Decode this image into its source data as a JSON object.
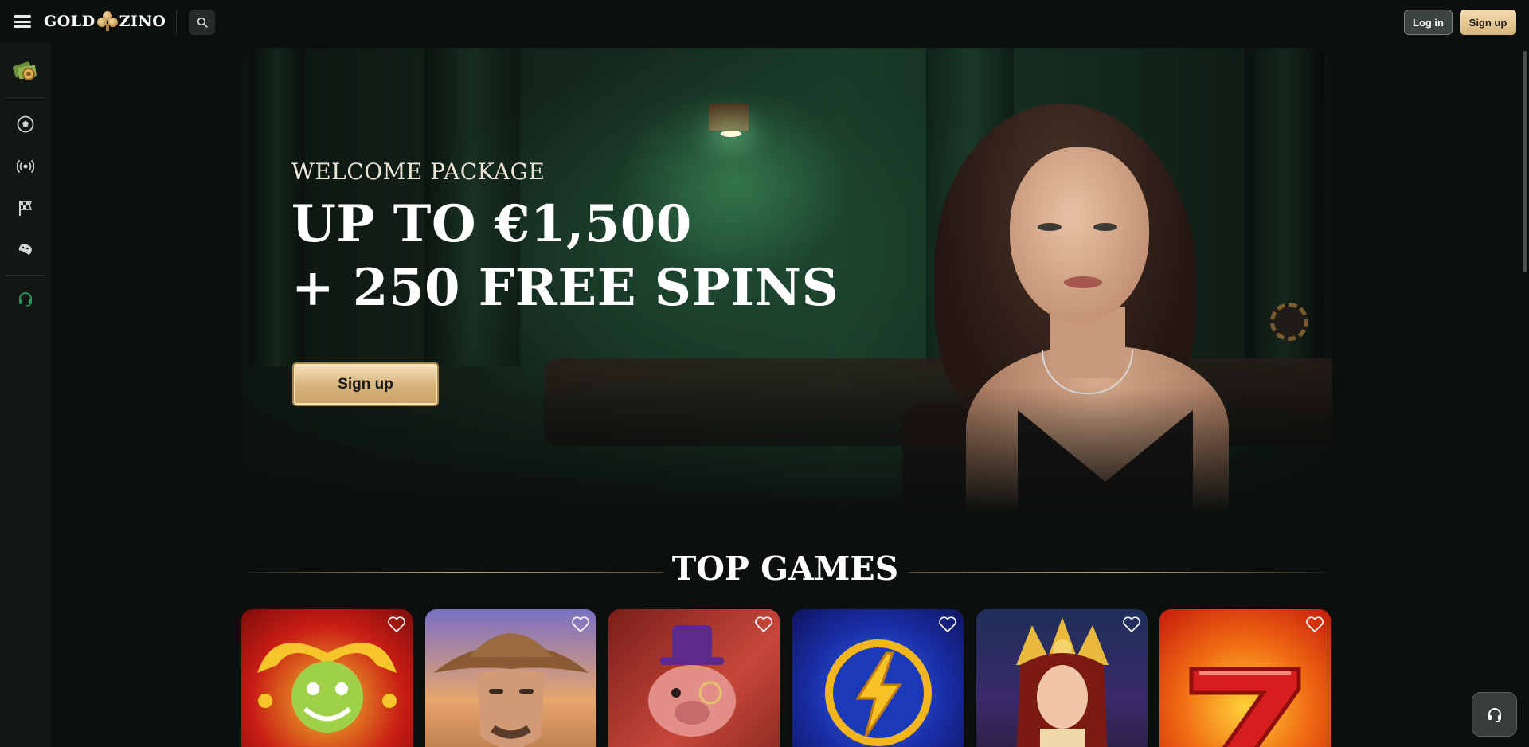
{
  "header": {
    "logo_left": "GOLD",
    "logo_right": "ZINO",
    "login_label": "Log in",
    "signup_label": "Sign up"
  },
  "sidebar": {
    "items": [
      {
        "name": "promotions",
        "icon": "cards-money-icon"
      },
      {
        "name": "sports",
        "icon": "soccer-ball-icon"
      },
      {
        "name": "live",
        "icon": "live-broadcast-icon"
      },
      {
        "name": "racing",
        "icon": "checkered-flag-icon"
      },
      {
        "name": "esports",
        "icon": "gamepad-icon"
      },
      {
        "name": "support",
        "icon": "headset-icon"
      }
    ]
  },
  "hero": {
    "kicker": "WELCOME PACKAGE",
    "title_line1": "UP TO €1,500",
    "title_line2": "+ 250 FREE SPINS",
    "cta_label": "Sign up"
  },
  "top_games": {
    "title": "TOP GAMES",
    "games": [
      {
        "theme": "joker"
      },
      {
        "theme": "cowboy"
      },
      {
        "theme": "pig-gentleman"
      },
      {
        "theme": "lightning"
      },
      {
        "theme": "empress"
      },
      {
        "theme": "hot-seven"
      }
    ]
  },
  "colors": {
    "background": "#0b0f0d",
    "sidebar": "#111814",
    "accent_gold": "#d8b47a",
    "support_green": "#1f9d55"
  }
}
